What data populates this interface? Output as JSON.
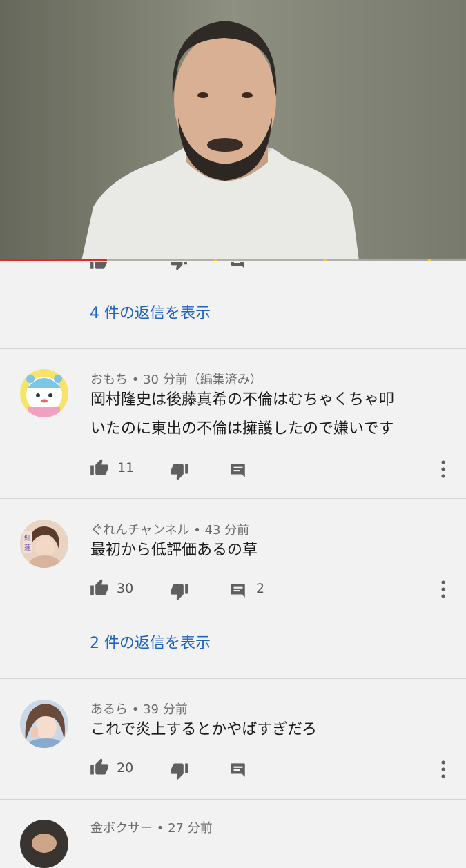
{
  "video": {
    "progress_played": 0.23
  },
  "thread_top": {
    "replies_label": "4 件の返信を表示"
  },
  "comments": [
    {
      "author": "おもち",
      "time": "30 分前（編集済み）",
      "text_lines": [
        "岡村隆史は後藤真希の不倫はむちゃくちゃ叩",
        "いたのに東出の不倫は擁護したので嫌いです"
      ],
      "likes": "11",
      "replies": ""
    },
    {
      "author": "ぐれんチャンネル",
      "time": "43 分前",
      "text_lines": [
        "最初から低評価あるの草"
      ],
      "likes": "30",
      "replies": "2",
      "replies_label": "2 件の返信を表示"
    },
    {
      "author": "あるら",
      "time": "39 分前",
      "text_lines": [
        "これで炎上するとかやばすぎだろ"
      ],
      "likes": "20",
      "replies": ""
    },
    {
      "author": "金ボクサー",
      "time": "27 分前"
    }
  ],
  "separator": " • ",
  "icons": [
    "like-icon",
    "dislike-icon",
    "reply-icon",
    "more-vert-icon"
  ],
  "colors": {
    "link": "#1e63c4",
    "progress": "#e32a1c",
    "background": "#f2f2f2"
  }
}
